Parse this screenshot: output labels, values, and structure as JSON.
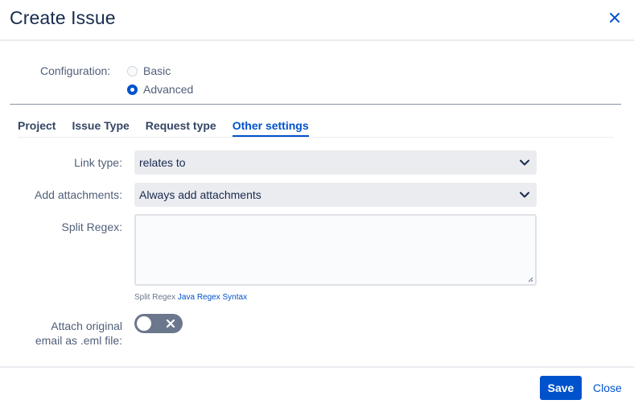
{
  "dialog": {
    "title": "Create Issue"
  },
  "configuration": {
    "label": "Configuration:",
    "options": [
      {
        "label": "Basic",
        "selected": false
      },
      {
        "label": "Advanced",
        "selected": true
      }
    ]
  },
  "tabs": [
    {
      "label": "Project",
      "active": false
    },
    {
      "label": "Issue Type",
      "active": false
    },
    {
      "label": "Request type",
      "active": false
    },
    {
      "label": "Other settings",
      "active": true
    }
  ],
  "form": {
    "link_type": {
      "label": "Link type:",
      "value": "relates to"
    },
    "add_attachments": {
      "label": "Add attachments:",
      "value": "Always add attachments"
    },
    "split_regex": {
      "label": "Split Regex:",
      "value": "",
      "hint_prefix": "Split Regex",
      "hint_link": "Java Regex Syntax"
    },
    "attach_original": {
      "label_line1": "Attach original",
      "label_line2": "email as .eml file:",
      "enabled": false
    }
  },
  "footer": {
    "save_label": "Save",
    "close_label": "Close"
  },
  "colors": {
    "accent": "#0052cc",
    "text": "#172b4d",
    "muted": "#505f79"
  },
  "icons": {
    "close": "close-icon",
    "chevron": "chevron-down-icon",
    "toggle_off": "cross-icon"
  }
}
